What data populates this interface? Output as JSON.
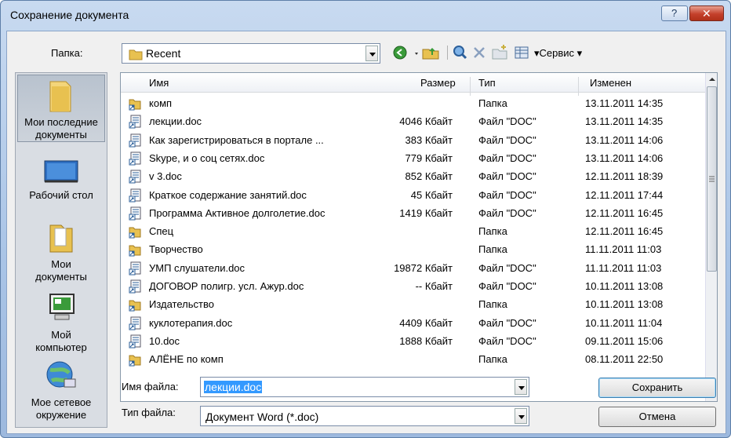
{
  "window": {
    "title": "Сохранение документа",
    "help_glyph": "?",
    "close_glyph": "✕"
  },
  "folder": {
    "label": "Папка:",
    "value": "Recent"
  },
  "toolbar": {
    "service_label": "▾Сервис ▾"
  },
  "places": [
    {
      "label_line1": "Мои последние",
      "label_line2": "документы"
    },
    {
      "label_line1": "Рабочий стол",
      "label_line2": ""
    },
    {
      "label_line1": "Мои",
      "label_line2": "документы"
    },
    {
      "label_line1": "Мой",
      "label_line2": "компьютер"
    },
    {
      "label_line1": "Мое сетевое",
      "label_line2": "окружение"
    }
  ],
  "columns": {
    "name": "Имя",
    "size": "Размер",
    "type": "Тип",
    "modified": "Изменен"
  },
  "files": [
    {
      "name": "комп",
      "size": "",
      "type": "Папка",
      "modified": "13.11.2011 14:35",
      "kind": "folder"
    },
    {
      "name": "лекции.doc",
      "size": "4046 Кбайт",
      "type": "Файл \"DOC\"",
      "modified": "13.11.2011 14:35",
      "kind": "doc"
    },
    {
      "name": "Как зарегистрироваться в портале ...",
      "size": "383 Кбайт",
      "type": "Файл \"DOC\"",
      "modified": "13.11.2011 14:06",
      "kind": "doc"
    },
    {
      "name": "Skype, и о соц сетях.doc",
      "size": "779 Кбайт",
      "type": "Файл \"DOC\"",
      "modified": "13.11.2011 14:06",
      "kind": "doc"
    },
    {
      "name": "v 3.doc",
      "size": "852 Кбайт",
      "type": "Файл \"DOC\"",
      "modified": "12.11.2011 18:39",
      "kind": "doc"
    },
    {
      "name": "Краткое содержание занятий.doc",
      "size": "45 Кбайт",
      "type": "Файл \"DOC\"",
      "modified": "12.11.2011 17:44",
      "kind": "doc"
    },
    {
      "name": "Программа Активное долголетие.doc",
      "size": "1419 Кбайт",
      "type": "Файл \"DOC\"",
      "modified": "12.11.2011 16:45",
      "kind": "doc"
    },
    {
      "name": "Спец",
      "size": "",
      "type": "Папка",
      "modified": "12.11.2011 16:45",
      "kind": "folder"
    },
    {
      "name": "Творчество",
      "size": "",
      "type": "Папка",
      "modified": "11.11.2011 11:03",
      "kind": "folder"
    },
    {
      "name": "УМП слушатели.doc",
      "size": "19872 Кбайт",
      "type": "Файл \"DOC\"",
      "modified": "11.11.2011 11:03",
      "kind": "doc"
    },
    {
      "name": "ДОГОВОР полигр. усл. Ажур.doc",
      "size": "-- Кбайт",
      "type": "Файл \"DOC\"",
      "modified": "10.11.2011 13:08",
      "kind": "doc"
    },
    {
      "name": "Издательство",
      "size": "",
      "type": "Папка",
      "modified": "10.11.2011 13:08",
      "kind": "folder"
    },
    {
      "name": "куклотерапия.doc",
      "size": "4409 Кбайт",
      "type": "Файл \"DOC\"",
      "modified": "10.11.2011 11:04",
      "kind": "doc"
    },
    {
      "name": "10.doc",
      "size": "1888 Кбайт",
      "type": "Файл \"DOC\"",
      "modified": "09.11.2011 15:06",
      "kind": "doc"
    },
    {
      "name": "АЛЁНЕ по комп",
      "size": "",
      "type": "Папка",
      "modified": "08.11.2011 22:50",
      "kind": "folder"
    }
  ],
  "filename": {
    "label": "Имя файла:",
    "value": "лекции.doc"
  },
  "filetype": {
    "label": "Тип файла:",
    "value": "Документ Word (*.doc)"
  },
  "buttons": {
    "save": "Сохранить",
    "cancel": "Отмена"
  }
}
